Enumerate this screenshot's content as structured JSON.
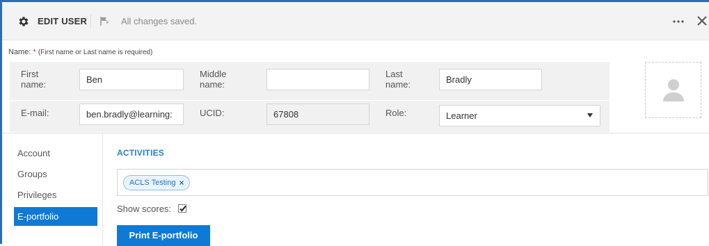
{
  "header": {
    "title": "EDIT USER",
    "status": "All changes saved."
  },
  "form": {
    "name_label": "Name:",
    "name_required": "*",
    "name_hint": "(First name or Last name is required)",
    "first_name": {
      "label": "First name:",
      "value": "Ben"
    },
    "middle_name": {
      "label": "Middle name:",
      "value": ""
    },
    "last_name": {
      "label": "Last name:",
      "value": "Bradly"
    },
    "email": {
      "label": "E-mail:",
      "value": "ben.bradly@learning:"
    },
    "ucid": {
      "label": "UCID:",
      "value": "67808"
    },
    "role": {
      "label": "Role:",
      "value": "Learner"
    }
  },
  "sidebar": {
    "items": [
      {
        "label": "Account"
      },
      {
        "label": "Groups"
      },
      {
        "label": "Privileges"
      },
      {
        "label": "E-portfolio",
        "active": true
      }
    ]
  },
  "main": {
    "section_title": "ACTIVITIES",
    "tags": [
      {
        "label": "ACLS Testing",
        "remove": "×"
      }
    ],
    "show_scores_label": "Show scores:",
    "show_scores_checked": true,
    "print_button": "Print E-portfolio"
  },
  "colors": {
    "accent": "#0f7ad6",
    "header_bg": "#f3f3f3",
    "form_bg": "#f1f1f1",
    "required": "#d9363e"
  },
  "icons": {
    "settings": "gear-icon",
    "saved": "flag-icon",
    "more": "more-icon",
    "close": "close-icon",
    "avatar": "user-placeholder-icon",
    "dropdown": "caret-down-icon",
    "remove_tag": "remove-icon",
    "checkbox": "check-icon"
  }
}
